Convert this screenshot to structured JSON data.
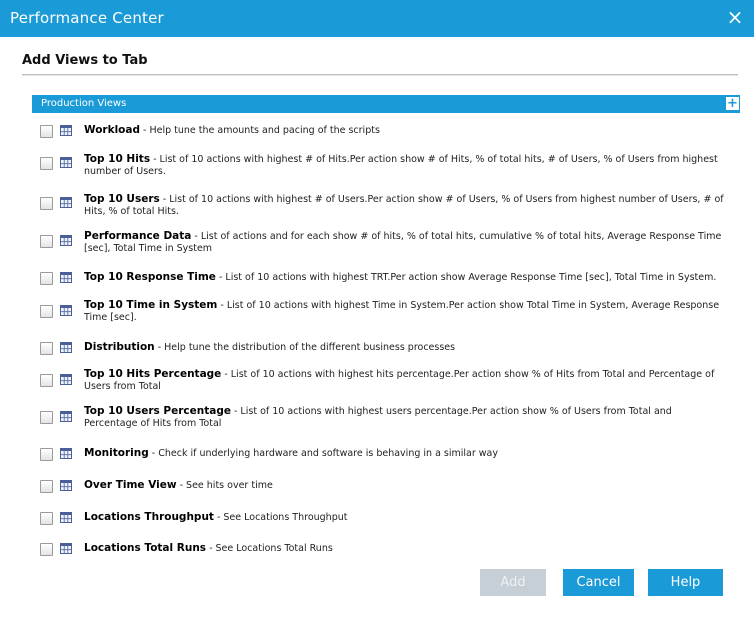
{
  "window": {
    "title": "Performance Center",
    "close_icon": "×"
  },
  "dialog": {
    "heading": "Add Views to Tab"
  },
  "section": {
    "label": "Production Views",
    "expand_icon": "+"
  },
  "views": [
    {
      "name": "Workload",
      "description": " - Help tune the amounts and pacing of the scripts"
    },
    {
      "name": "Top 10 Hits",
      "description": " - List of 10 actions with highest # of Hits.Per action show # of Hits, % of total hits, # of Users, % of Users from highest number of Users."
    },
    {
      "name": "Top 10 Users",
      "description": " - List of 10 actions with highest # of Users.Per action show # of Users, % of Users from highest number of Users, # of Hits, % of total Hits."
    },
    {
      "name": "Performance Data",
      "description": " - List of actions and for each show # of hits, % of total hits, cumulative % of total hits, Average Response Time [sec], Total Time in System"
    },
    {
      "name": "Top 10 Response Time",
      "description": " - List of 10 actions with highest TRT.Per action show Average Response Time [sec], Total Time in System."
    },
    {
      "name": "Top 10 Time in System",
      "description": " - List of 10 actions with highest Time in System.Per action show Total Time in System, Average Response Time [sec]."
    },
    {
      "name": "Distribution",
      "description": " - Help tune the distribution of the different business processes"
    },
    {
      "name": "Top 10 Hits Percentage",
      "description": " - List of 10 actions with highest hits percentage.Per action show % of Hits from Total and Percentage of Users from Total"
    },
    {
      "name": "Top 10 Users Percentage",
      "description": " - List of 10 actions with highest users percentage.Per action show % of Users from Total and Percentage of Hits from Total"
    },
    {
      "name": "Monitoring",
      "description": " - Check if underlying hardware and software is behaving in a similar way"
    },
    {
      "name": "Over Time View",
      "description": " - See hits over time"
    },
    {
      "name": "Locations Throughput",
      "description": " - See Locations Throughput"
    },
    {
      "name": "Locations Total Runs",
      "description": " - See Locations Total Runs"
    }
  ],
  "buttons": {
    "add": "Add",
    "cancel": "Cancel",
    "help": "Help"
  },
  "colors": {
    "accent": "#1a9ad6",
    "disabled_button": "#c6cfd6"
  }
}
